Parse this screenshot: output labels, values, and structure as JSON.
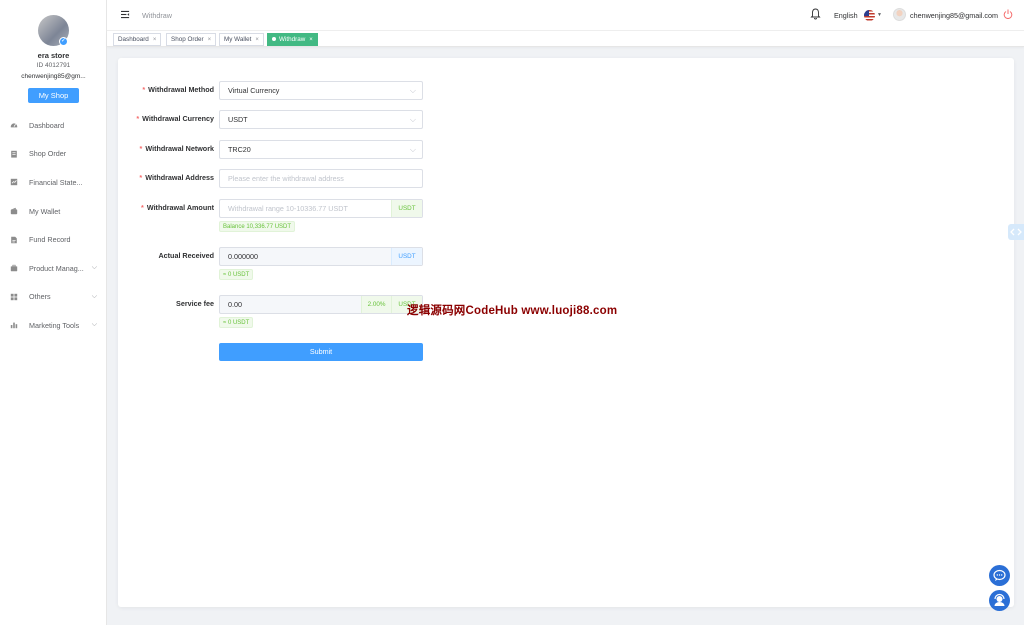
{
  "sidebar": {
    "store_name": "era store",
    "store_id": "ID 4012791",
    "email": "chenwenjing85@gm...",
    "my_shop_label": "My Shop",
    "items": [
      {
        "label": "Dashboard",
        "icon": "dashboard-icon",
        "expandable": false
      },
      {
        "label": "Shop Order",
        "icon": "order-icon",
        "expandable": false
      },
      {
        "label": "Financial State...",
        "icon": "financial-icon",
        "expandable": false
      },
      {
        "label": "My Wallet",
        "icon": "wallet-icon",
        "expandable": false
      },
      {
        "label": "Fund Record",
        "icon": "record-icon",
        "expandable": false
      },
      {
        "label": "Product Manag...",
        "icon": "briefcase-icon",
        "expandable": true
      },
      {
        "label": "Others",
        "icon": "grid-icon",
        "expandable": true
      },
      {
        "label": "Marketing Tools",
        "icon": "bar-chart-icon",
        "expandable": true
      }
    ]
  },
  "header": {
    "breadcrumb": "Withdraw",
    "language": "English",
    "user_email": "chenwenjing85@gmail.com"
  },
  "tags": [
    {
      "label": "Dashboard",
      "active": false
    },
    {
      "label": "Shop Order",
      "active": false
    },
    {
      "label": "My Wallet",
      "active": false
    },
    {
      "label": "Withdraw",
      "active": true
    }
  ],
  "form": {
    "method": {
      "label": "Withdrawal Method",
      "value": "Virtual Currency"
    },
    "currency": {
      "label": "Withdrawal Currency",
      "value": "USDT"
    },
    "network": {
      "label": "Withdrawal Network",
      "value": "TRC20"
    },
    "address": {
      "label": "Withdrawal Address",
      "placeholder": "Please enter the withdrawal address"
    },
    "amount": {
      "label": "Withdrawal Amount",
      "placeholder": "Withdrawal range 10-10336.77 USDT",
      "unit": "USDT",
      "balance": "Balance 10,336.77 USDT"
    },
    "received": {
      "label": "Actual Received",
      "value": "0.000000",
      "unit": "USDT",
      "approx": "≈ 0 USDT"
    },
    "fee": {
      "label": "Service fee",
      "value": "0.00",
      "rate": "2.00%",
      "unit": "USDT",
      "approx": "≈ 0 USDT"
    },
    "submit_label": "Submit"
  },
  "watermark": "逻辑源码网CodeHub www.luoji88.com",
  "colors": {
    "primary": "#409eff",
    "active_tag": "#42b983",
    "required": "#f56c6c",
    "success": "#67c23a"
  }
}
